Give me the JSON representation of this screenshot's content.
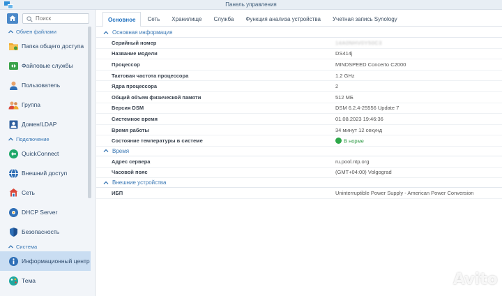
{
  "window": {
    "title": "Панель управления"
  },
  "sidebar": {
    "search_placeholder": "Поиск",
    "sections": [
      {
        "label": "Обмен файлами",
        "items": [
          {
            "label": "Папка общего доступа",
            "icon": "folder-share-icon"
          },
          {
            "label": "Файловые службы",
            "icon": "file-services-icon"
          },
          {
            "label": "Пользователь",
            "icon": "user-icon"
          },
          {
            "label": "Группа",
            "icon": "group-icon"
          },
          {
            "label": "Домен/LDAP",
            "icon": "domain-ldap-icon"
          }
        ]
      },
      {
        "label": "Подключение",
        "items": [
          {
            "label": "QuickConnect",
            "icon": "quickconnect-icon"
          },
          {
            "label": "Внешний доступ",
            "icon": "external-access-icon"
          },
          {
            "label": "Сеть",
            "icon": "network-icon"
          },
          {
            "label": "DHCP Server",
            "icon": "dhcp-server-icon"
          },
          {
            "label": "Безопасность",
            "icon": "security-icon"
          }
        ]
      },
      {
        "label": "Система",
        "items": [
          {
            "label": "Информационный центр",
            "icon": "info-center-icon",
            "active": true
          },
          {
            "label": "Тема",
            "icon": "theme-icon"
          }
        ]
      }
    ]
  },
  "tabs": [
    "Основное",
    "Сеть",
    "Хранилище",
    "Служба",
    "Функция анализа устройства",
    "Учетная запись Synology"
  ],
  "groups": {
    "basic": {
      "title": "Основная информация",
      "rows": [
        {
          "key": "Серийный номер",
          "value": "14A0NHV0Y50C3"
        },
        {
          "key": "Название модели",
          "value": "DS414j"
        },
        {
          "key": "Процессор",
          "value": "MINDSPEED Concerto C2000"
        },
        {
          "key": "Тактовая частота процессора",
          "value": "1.2 GHz"
        },
        {
          "key": "Ядра процессора",
          "value": "2"
        },
        {
          "key": "Общий объем физической памяти",
          "value": "512 МБ"
        },
        {
          "key": "Версия DSM",
          "value": "DSM 6.2.4-25556 Update 7"
        },
        {
          "key": "Системное время",
          "value": "01.08.2023 19:46:36"
        },
        {
          "key": "Время работы",
          "value": "34 минут 12 секунд"
        },
        {
          "key": "Состояние температуры в системе",
          "value": "В норме"
        }
      ]
    },
    "time": {
      "title": "Время",
      "rows": [
        {
          "key": "Адрес сервера",
          "value": "ru.pool.ntp.org"
        },
        {
          "key": "Часовой пояс",
          "value": "(GMT+04:00) Volgograd"
        }
      ]
    },
    "external": {
      "title": "Внешние устройства",
      "rows": [
        {
          "key": "ИБП",
          "value": "Uninterruptible Power Supply - American Power Conversion"
        }
      ]
    }
  },
  "watermark": {
    "text": "Avito"
  },
  "colors": {
    "accent": "#3a78b5",
    "active_bg": "#c9ddf2",
    "status_ok": "#2ea84a"
  }
}
